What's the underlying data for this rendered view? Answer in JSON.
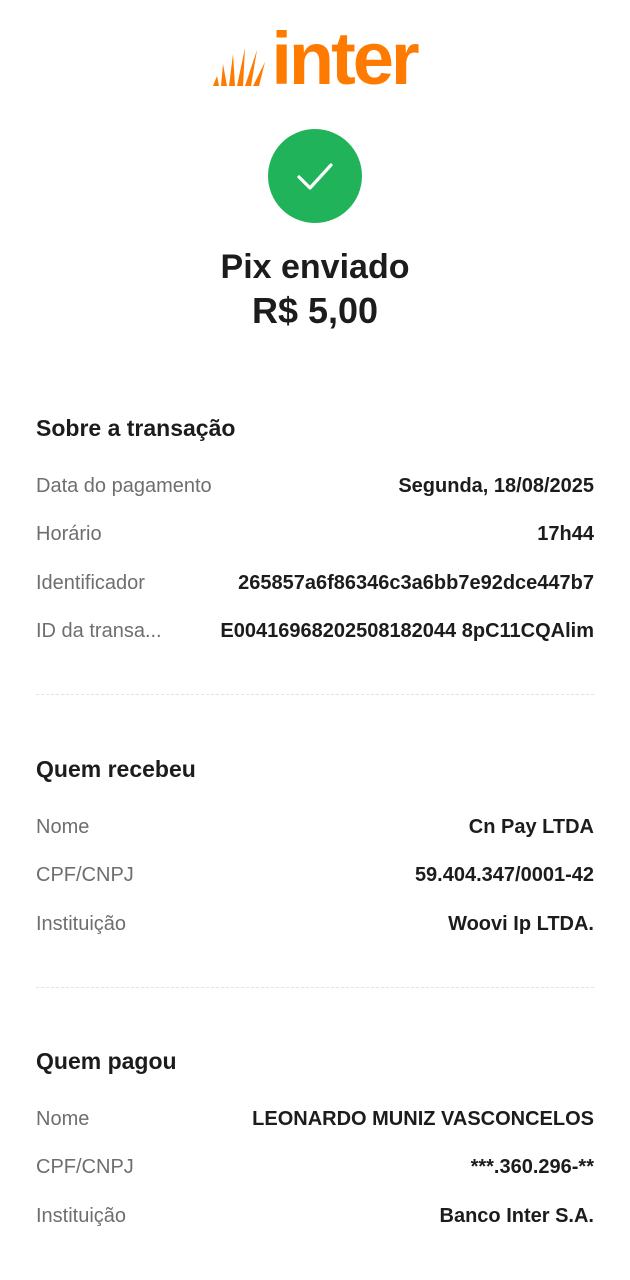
{
  "brand": {
    "name": "inter",
    "color": "#ff7a00"
  },
  "status": {
    "icon": "check-icon",
    "color": "#21b35a",
    "title": "Pix enviado",
    "amount": "R$ 5,00"
  },
  "transaction": {
    "title": "Sobre a transação",
    "rows": [
      {
        "label": "Data do pagamento",
        "value": "Segunda, 18/08/2025"
      },
      {
        "label": "Horário",
        "value": "17h44"
      },
      {
        "label": "Identificador",
        "value": "265857a6f86346c3a6bb7e92dce447b7"
      },
      {
        "label": "ID da transa...",
        "value": "E00416968202508182044 8pC11CQAlim"
      }
    ]
  },
  "receiver": {
    "title": "Quem recebeu",
    "rows": [
      {
        "label": "Nome",
        "value": "Cn Pay LTDA"
      },
      {
        "label": "CPF/CNPJ",
        "value": "59.404.347/0001-42"
      },
      {
        "label": "Instituição",
        "value": "Woovi Ip LTDA."
      }
    ]
  },
  "payer": {
    "title": "Quem pagou",
    "rows": [
      {
        "label": "Nome",
        "value": "LEONARDO MUNIZ VASCONCELOS"
      },
      {
        "label": "CPF/CNPJ",
        "value": "***.360.296-**"
      },
      {
        "label": "Instituição",
        "value": "Banco Inter S.A."
      }
    ]
  }
}
